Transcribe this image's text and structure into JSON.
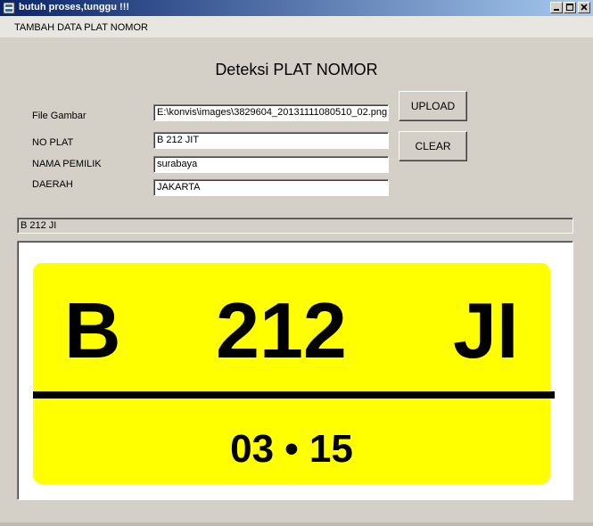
{
  "window": {
    "title": "butuh proses,tunggu !!!",
    "controls": [
      "minimize",
      "maximize",
      "close"
    ]
  },
  "menu": {
    "items": [
      {
        "label": "TAMBAH DATA PLAT NOMOR"
      }
    ]
  },
  "form": {
    "heading": "Deteksi  PLAT NOMOR",
    "labels": {
      "file": "File Gambar",
      "plate": "NO PLAT",
      "owner": "NAMA PEMILIK",
      "region": "DAERAH"
    },
    "values": {
      "file": "E:\\konvis\\images\\3829604_20131111080510_02.png",
      "plate": "B 212 JIT",
      "owner": "surabaya",
      "region": "JAKARTA"
    },
    "buttons": {
      "upload": "UPLOAD",
      "clear": "CLEAR"
    }
  },
  "result": {
    "text": "B 212 JI"
  },
  "plate_image": {
    "main": "B    212    JI",
    "letters": "B",
    "number": "212",
    "suffix": "JI",
    "date": "03 • 15",
    "colors": {
      "plate": "#ffff00",
      "text": "#000000"
    }
  }
}
